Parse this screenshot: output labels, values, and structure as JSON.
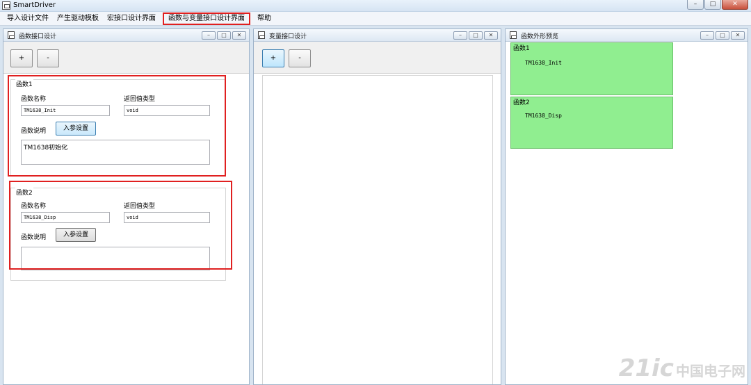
{
  "window": {
    "title": "SmartDriver",
    "minimize": "–",
    "maximize": "□",
    "close": "✕"
  },
  "menu": [
    {
      "label": "导入设计文件"
    },
    {
      "label": "产生驱动模板"
    },
    {
      "label": "宏接口设计界面"
    },
    {
      "label": "函数与变量接口设计界面",
      "highlighted": true
    },
    {
      "label": "帮助"
    }
  ],
  "panels": {
    "function": {
      "title": "函数接口设计",
      "add_label": "+",
      "remove_label": "-",
      "groups": [
        {
          "title": "函数1",
          "name_label": "函数名称",
          "name_value": "TM1638_Init",
          "return_label": "返回值类型",
          "return_value": "void",
          "desc_label": "函数说明",
          "param_button": "入参设置",
          "desc_value": "TM1638初始化"
        },
        {
          "title": "函数2",
          "name_label": "函数名称",
          "name_value": "TM1638_Disp",
          "return_label": "返回值类型",
          "return_value": "void",
          "desc_label": "函数说明",
          "param_button": "入参设置",
          "desc_value": ""
        }
      ]
    },
    "variable": {
      "title": "变量接口设计",
      "add_label": "+",
      "remove_label": "-"
    },
    "preview": {
      "title": "函数外形预览",
      "items": [
        {
          "tag": "函数1",
          "name": "TM1638_Init"
        },
        {
          "tag": "函数2",
          "name": "TM1638_Disp"
        }
      ]
    }
  },
  "panel_buttons": {
    "minimize": "–",
    "restore": "□",
    "close": "✕"
  },
  "watermark": {
    "big": "21ic",
    "small": "中国电子网"
  },
  "colors": {
    "highlight_red": "#e02020",
    "preview_green": "#90ee90"
  }
}
